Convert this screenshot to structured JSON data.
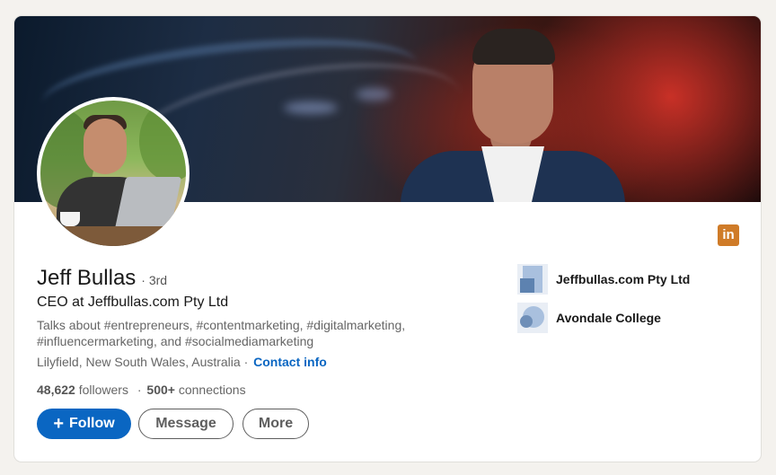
{
  "profile": {
    "name": "Jeff Bullas",
    "degree": "· 3rd",
    "headline": "CEO at Jeffbullas.com Pty Ltd",
    "talks_about": "Talks about #entrepreneurs, #contentmarketing, #digitalmarketing, #influencermarketing, and #socialmediamarketing",
    "location": "Lilyfield, New South Wales, Australia ·",
    "contact_info": "Contact info",
    "followers_count": "48,622",
    "followers_label": "followers",
    "stats_separator": "·",
    "connections_count": "500+",
    "connections_label": "connections"
  },
  "actions": {
    "follow_plus": "+",
    "follow": "Follow",
    "message": "Message",
    "more": "More"
  },
  "companies": [
    {
      "name": "Jeffbullas.com Pty Ltd",
      "icon": "company-logo"
    },
    {
      "name": "Avondale College",
      "icon": "school-logo"
    }
  ],
  "badge": {
    "text": "in",
    "color": "#cf7b28"
  },
  "colors": {
    "primary": "#0a66c2",
    "text": "#191919",
    "muted": "#666666",
    "background": "#f4f2ee"
  }
}
